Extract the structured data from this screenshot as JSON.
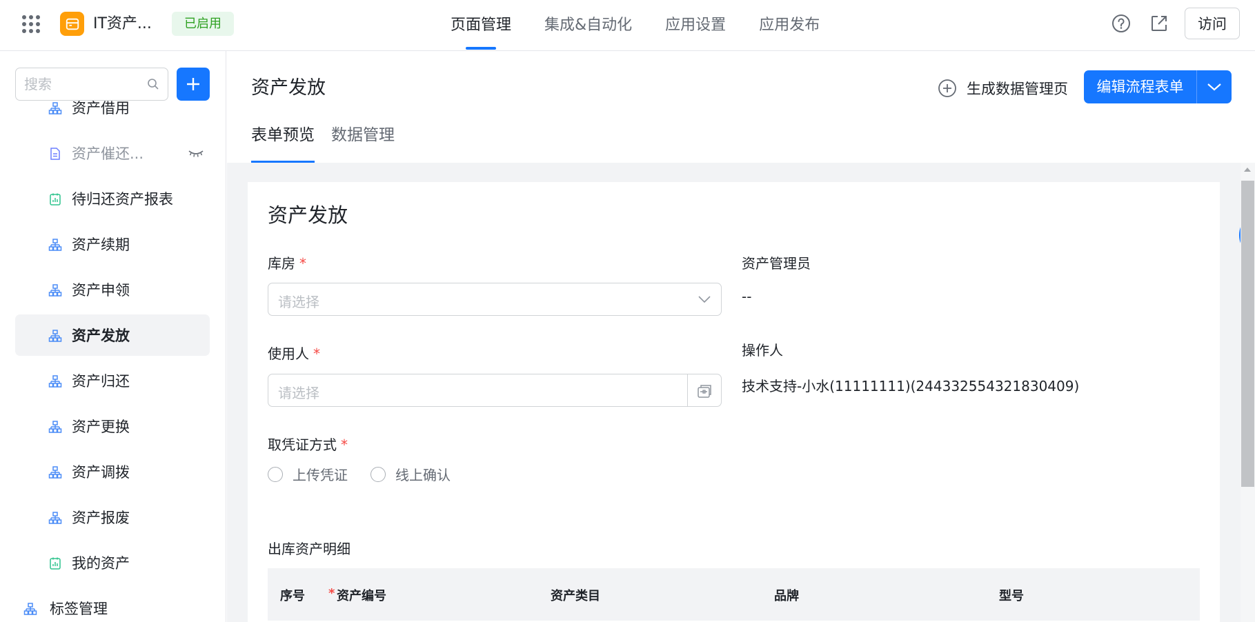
{
  "app": {
    "name": "IT资产...",
    "status": "已启用"
  },
  "top_nav": {
    "tabs": [
      {
        "label": "页面管理",
        "active": true
      },
      {
        "label": "集成&自动化",
        "active": false
      },
      {
        "label": "应用设置",
        "active": false
      },
      {
        "label": "应用发布",
        "active": false
      }
    ],
    "visit_label": "访问"
  },
  "sidebar": {
    "search_placeholder": "搜索",
    "items": [
      {
        "label": "资产借用",
        "icon": "flow-icon"
      },
      {
        "label": "资产催还...",
        "icon": "form-icon",
        "hidden": true
      },
      {
        "label": "待归还资产报表",
        "icon": "report-icon"
      },
      {
        "label": "资产续期",
        "icon": "flow-icon"
      },
      {
        "label": "资产申领",
        "icon": "flow-icon"
      },
      {
        "label": "资产发放",
        "icon": "flow-icon",
        "active": true
      },
      {
        "label": "资产归还",
        "icon": "flow-icon"
      },
      {
        "label": "资产更换",
        "icon": "flow-icon"
      },
      {
        "label": "资产调拨",
        "icon": "flow-icon"
      },
      {
        "label": "资产报废",
        "icon": "flow-icon"
      },
      {
        "label": "我的资产",
        "icon": "report-icon"
      },
      {
        "label": "标签管理",
        "icon": "flow-icon"
      }
    ]
  },
  "main": {
    "title": "资产发放",
    "generate_label": "生成数据管理页",
    "edit_label": "编辑流程表单",
    "tabs": [
      {
        "label": "表单预览",
        "active": true
      },
      {
        "label": "数据管理",
        "active": false
      }
    ]
  },
  "form": {
    "title": "资产发放",
    "warehouse": {
      "label": "库房",
      "required": "*",
      "placeholder": "请选择"
    },
    "asset_manager": {
      "label": "资产管理员",
      "value": "--"
    },
    "user": {
      "label": "使用人",
      "required": "*",
      "placeholder": "请选择"
    },
    "operator": {
      "label": "操作人",
      "value": "技术支持-小水(11111111)(244332554321830409)"
    },
    "voucher": {
      "label": "取凭证方式",
      "required": "*",
      "options": [
        "上传凭证",
        "线上确认"
      ]
    },
    "detail_section": "出库资产明细",
    "table_headers": {
      "seq": "序号",
      "asset_no_req": "*",
      "asset_no": "资产编号",
      "category": "资产类目",
      "brand": "品牌",
      "model": "型号"
    }
  },
  "colors": {
    "primary": "#1677ff",
    "logo": "#ff9f0a",
    "status_bg": "#e8f7ec",
    "status_text": "#2ea121",
    "required": "#f54a45",
    "flow_icon": "#4a8cf7",
    "report_icon": "#2fc48d"
  }
}
